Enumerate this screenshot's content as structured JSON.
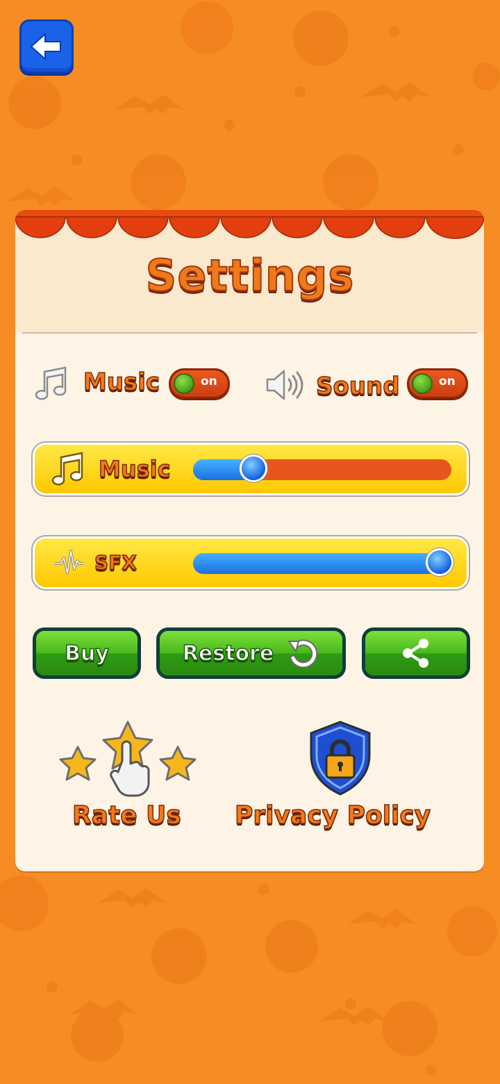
{
  "header": {
    "title": "Settings"
  },
  "toggles": {
    "music": {
      "label": "Music",
      "state": "on"
    },
    "sound": {
      "label": "Sound",
      "state": "on"
    }
  },
  "sliders": {
    "music": {
      "label": "Music",
      "value_fraction": 0.28
    },
    "sfx": {
      "label": "SFX",
      "value_fraction": 1.0
    }
  },
  "buttons": {
    "buy": "Buy",
    "restore": "Restore"
  },
  "links": {
    "rate_us": "Rate Us",
    "privacy_policy": "Privacy Policy"
  },
  "colors": {
    "background": "#f68d24",
    "panel": "#fdf4e5",
    "accent_orange": "#f27a18",
    "toggle_on": "#3d9a17",
    "slider_fill": "#1a6fe0",
    "slider_bar": "#ffd200",
    "button_green": "#47b81c"
  },
  "icons": [
    "back-arrow-icon",
    "music-note-icon",
    "speaker-icon",
    "waveform-icon",
    "restore-icon",
    "share-icon",
    "stars-hand-icon",
    "shield-lock-icon"
  ]
}
